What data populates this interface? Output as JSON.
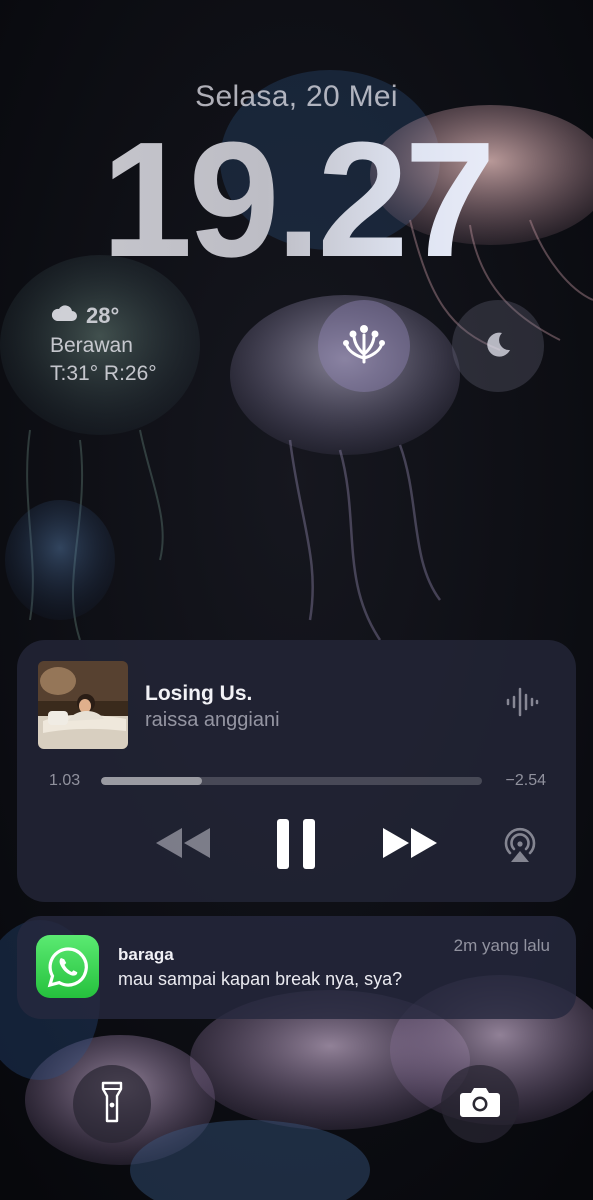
{
  "lockscreen": {
    "date": "Selasa, 20 Mei",
    "time": "19.27"
  },
  "weather": {
    "temperature": "28°",
    "condition": "Berawan",
    "high_low": "T:31° R:26°",
    "icon": "cloud-icon"
  },
  "widgets": {
    "focus_icon": "focus-flower-icon",
    "sleep_icon": "moon-icon"
  },
  "now_playing": {
    "title": "Losing Us.",
    "artist": "raissa anggiani",
    "elapsed": "1.03",
    "remaining": "−2.54",
    "progress": 0.266,
    "controls": [
      "rewind-icon",
      "pause-icon",
      "fast-forward-icon",
      "airplay-icon"
    ]
  },
  "notification": {
    "app_icon": "whatsapp-icon",
    "sender": "baraga",
    "message": "mau sampai kapan break nya, sya?",
    "time": "2m yang lalu"
  },
  "quick_actions": {
    "left_icon": "flashlight-icon",
    "right_icon": "camera-icon"
  },
  "colors": {
    "whatsapp_green": "#25c13d",
    "player_bg": "#222436",
    "notification_bg": "#26283e"
  }
}
